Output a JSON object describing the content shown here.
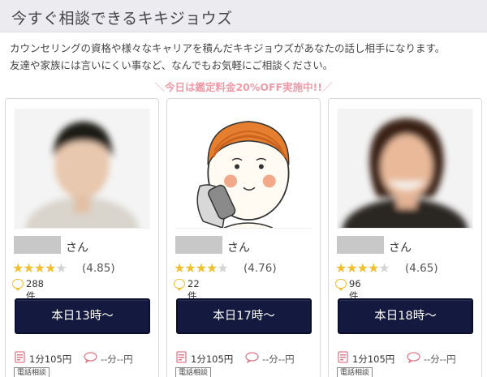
{
  "header": {
    "title": "今すぐ相談できるキキジョウズ"
  },
  "intro": {
    "line1": "カウンセリングの資格や様々なキャリアを積んだキキジョウズがあなたの話し相手になります。",
    "line2": "友達や家族には言いにくい事など、なんでもお気軽にご相談ください。"
  },
  "promo": {
    "text": "今日は鑑定料金20%OFF実施中!!",
    "left_mark": "＼",
    "right_mark": "／"
  },
  "colors": {
    "accent_pink": "#f09aa7",
    "cta_navy": "#141a3f",
    "star_gold": "#f0c030"
  },
  "cards": [
    {
      "photo": "blurred-portrait-photo",
      "name_suffix": "さん",
      "stars_full": "★★★★",
      "stars_empty": "★",
      "rating": "(4.85)",
      "rating_value": 4.85,
      "reviews": "288件",
      "cta_label": "本日13時〜",
      "phone_price": "1分105円",
      "mail_price": "--分--円",
      "tag": "電話相談"
    },
    {
      "photo": "illustrated-avatar",
      "name_suffix": "さん",
      "stars_full": "★★★★",
      "stars_empty": "★",
      "rating": "(4.76)",
      "rating_value": 4.76,
      "reviews": "22件",
      "cta_label": "本日17時〜",
      "phone_price": "1分105円",
      "mail_price": "--分--円",
      "tag": "電話相談"
    },
    {
      "photo": "blurred-portrait-photo",
      "name_suffix": "さん",
      "stars_full": "★★★★",
      "stars_empty": "★",
      "rating": "(4.65)",
      "rating_value": 4.65,
      "reviews": "96件",
      "cta_label": "本日18時〜",
      "phone_price": "1分105円",
      "mail_price": "--分--円",
      "tag": "電話相談"
    }
  ]
}
